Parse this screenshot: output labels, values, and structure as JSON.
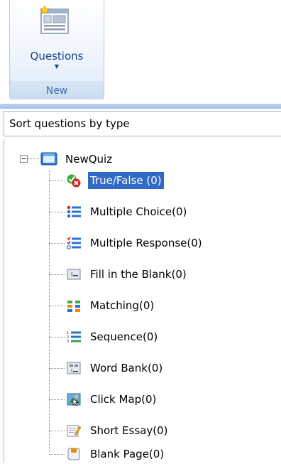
{
  "ribbon": {
    "button_label": "Questions",
    "button_icon": "questions-layout-icon",
    "group_caption": "New"
  },
  "sort": {
    "label": "Sort questions by type"
  },
  "tree": {
    "root": {
      "label": "NewQuiz",
      "icon": "quiz-icon"
    },
    "items": [
      {
        "label": "True/False (0)",
        "icon": "true-false-icon",
        "selected": true
      },
      {
        "label": "Multiple Choice(0)",
        "icon": "multiple-choice-icon"
      },
      {
        "label": "Multiple Response(0)",
        "icon": "multiple-response-icon"
      },
      {
        "label": "Fill in the Blank(0)",
        "icon": "fill-blank-icon"
      },
      {
        "label": "Matching(0)",
        "icon": "matching-icon"
      },
      {
        "label": "Sequence(0)",
        "icon": "sequence-icon"
      },
      {
        "label": "Word Bank(0)",
        "icon": "word-bank-icon"
      },
      {
        "label": "Click Map(0)",
        "icon": "click-map-icon"
      },
      {
        "label": "Short Essay(0)",
        "icon": "short-essay-icon"
      },
      {
        "label": "Blank Page(0)",
        "icon": "blank-page-icon"
      }
    ]
  },
  "colors": {
    "selection": "#316ac5",
    "ribbon_text": "#15428b"
  }
}
